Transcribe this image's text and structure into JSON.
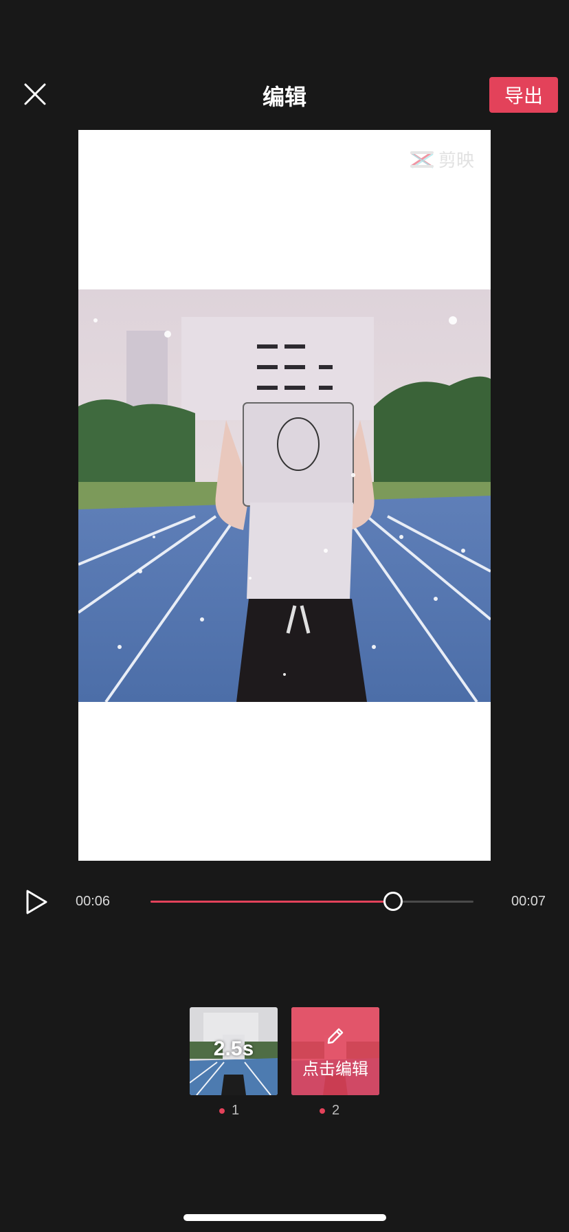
{
  "header": {
    "title": "编辑",
    "export_label": "导出"
  },
  "preview": {
    "watermark_text": "剪映"
  },
  "playback": {
    "current_time": "00:06",
    "total_time": "00:07",
    "progress": 0.75
  },
  "clips": [
    {
      "index": "1",
      "duration": "2.5s"
    },
    {
      "index": "2",
      "edit_label": "点击编辑"
    }
  ],
  "colors": {
    "accent": "#e3425a",
    "background": "#181818"
  }
}
